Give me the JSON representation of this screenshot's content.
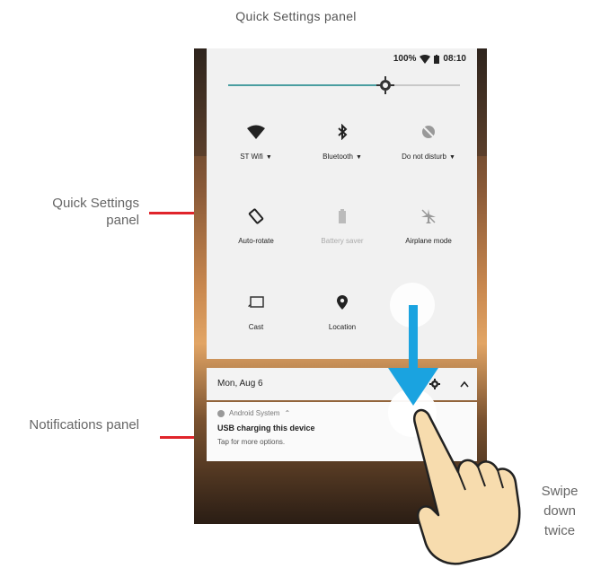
{
  "captions": {
    "top": "Quick Settings panel",
    "left_top": "Quick Settings panel",
    "left_bottom": "Notifications panel",
    "swipe": "Swipe down twice"
  },
  "status_bar": {
    "battery": "100%",
    "time": "08:10"
  },
  "brightness": {
    "level_percent": 68
  },
  "tiles": [
    {
      "label": "ST Wifi",
      "icon": "wifi-icon",
      "dropdown": true
    },
    {
      "label": "Bluetooth",
      "icon": "bluetooth-icon",
      "dropdown": true
    },
    {
      "label": "Do not disturb",
      "icon": "do-not-disturb-icon",
      "dropdown": true
    },
    {
      "label": "Auto-rotate",
      "icon": "auto-rotate-icon"
    },
    {
      "label": "Battery saver",
      "icon": "battery-saver-icon",
      "disabled": true
    },
    {
      "label": "Airplane mode",
      "icon": "airplane-mode-icon"
    },
    {
      "label": "Cast",
      "icon": "cast-icon"
    },
    {
      "label": "Location",
      "icon": "location-icon"
    }
  ],
  "date_bar": {
    "date": "Mon, Aug 6"
  },
  "notification": {
    "app": "Android System",
    "title": "USB charging this device",
    "body": "Tap for more options."
  },
  "colors": {
    "callout_red": "#e0242b",
    "arrow_blue": "#1aa3e0",
    "slider_accent": "#4a9ea0",
    "hand_fill": "#f7dcae"
  }
}
